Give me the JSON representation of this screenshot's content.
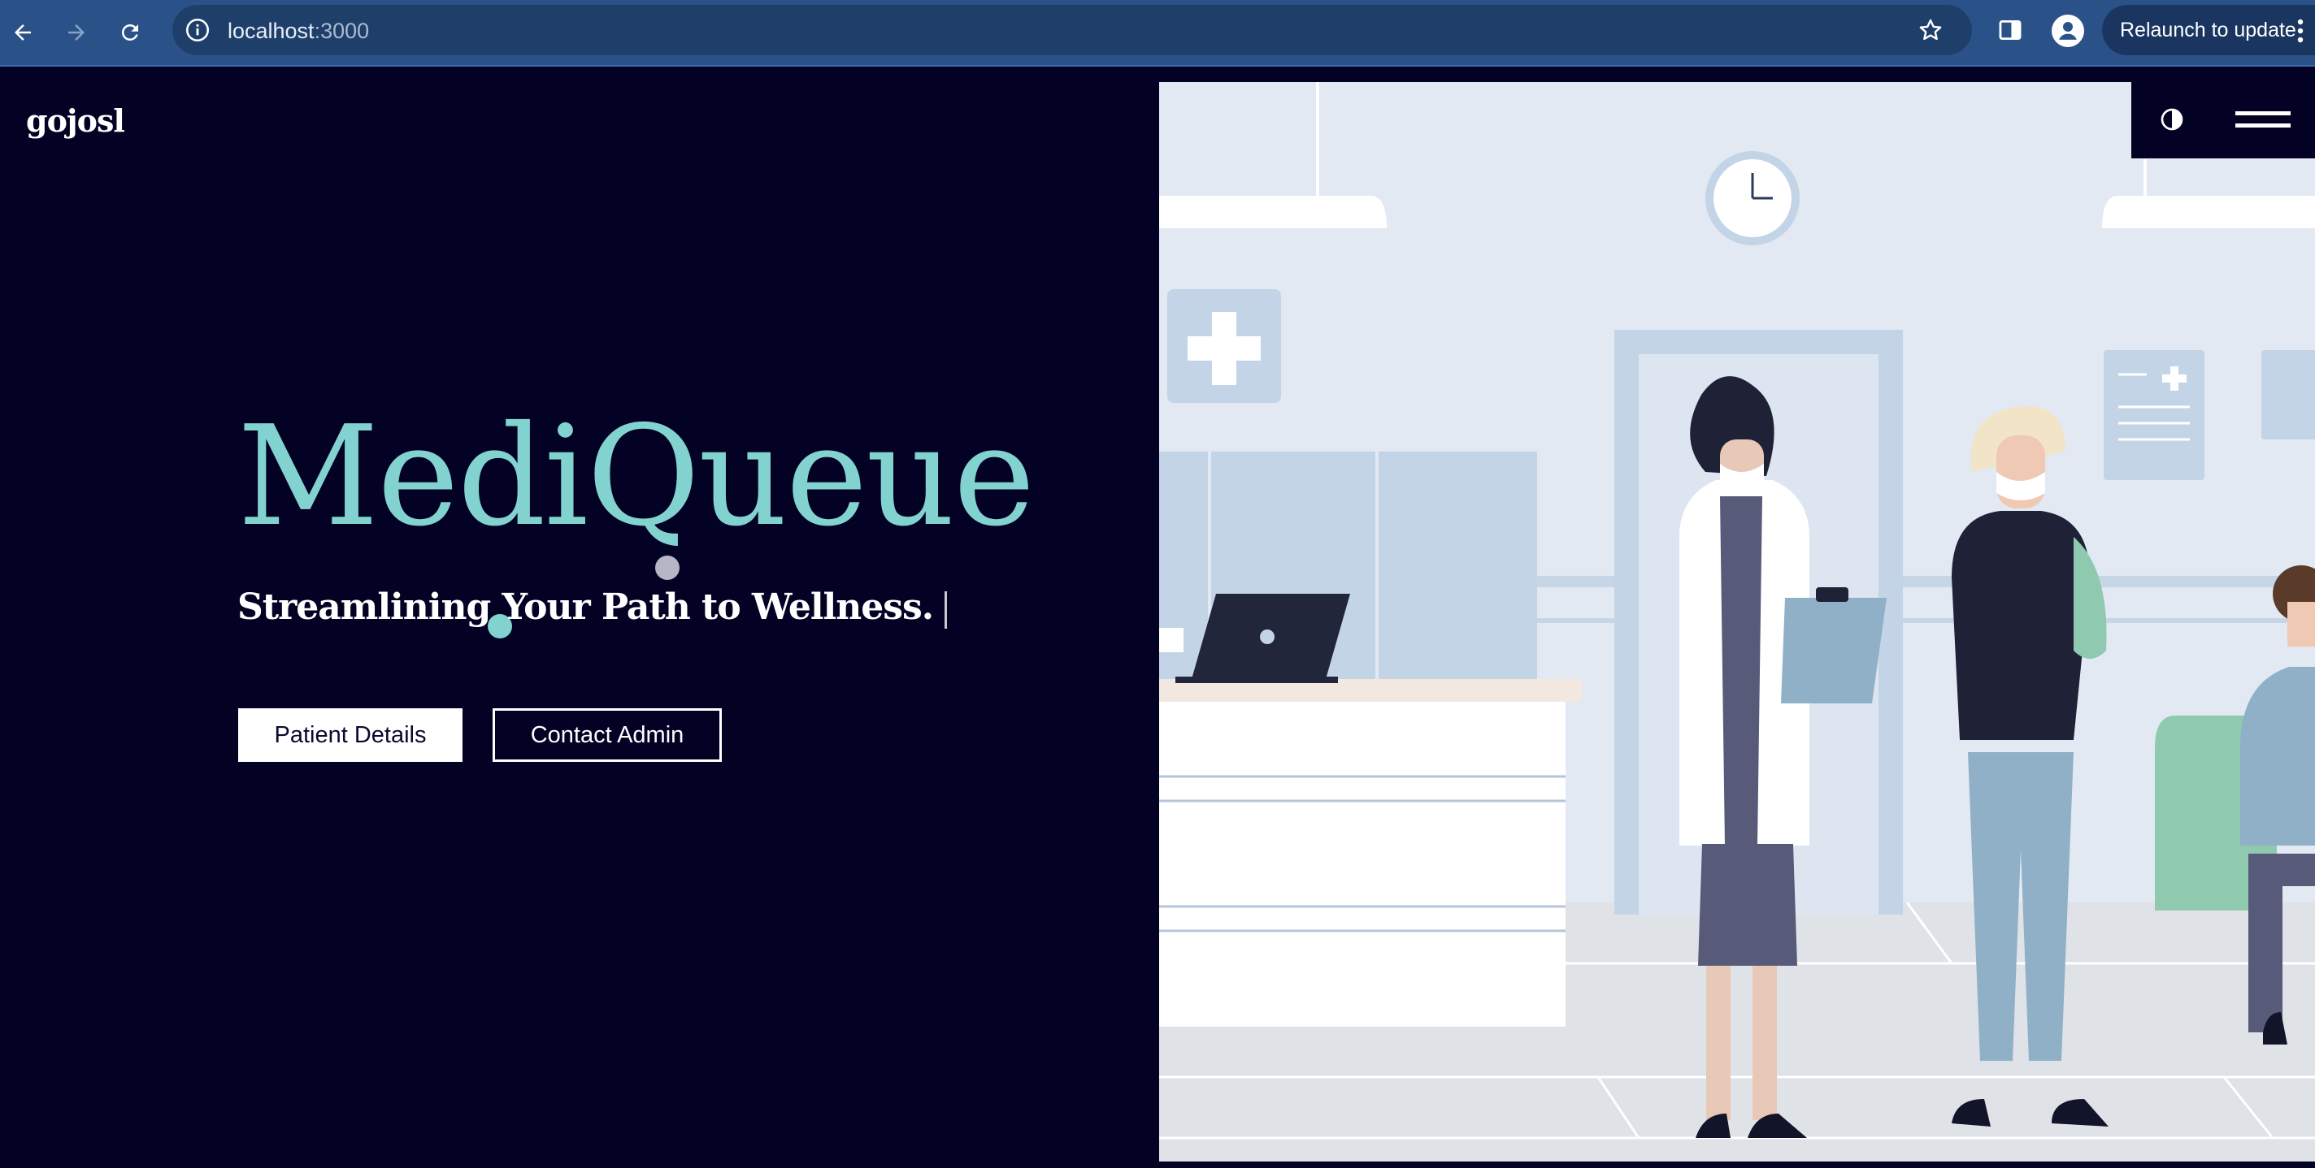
{
  "browser": {
    "url_host": "localhost",
    "url_port": ":3000",
    "relaunch_label": "Relaunch to update",
    "icons": [
      "back-arrow-icon",
      "forward-arrow-icon",
      "reload-icon",
      "site-info-icon",
      "star-icon",
      "side-panel-icon",
      "profile-icon",
      "more-vert-icon"
    ]
  },
  "header": {
    "logo": "gojosl",
    "icons": [
      "theme-toggle-icon",
      "hamburger-menu-icon"
    ]
  },
  "hero": {
    "title": "MediQueue",
    "subtitle": "Streamlining Your Path to Wellness.",
    "buttons": {
      "patient_details": "Patient Details",
      "contact_admin": "Contact Admin"
    }
  },
  "colors": {
    "background": "#040224",
    "accent": "#82d2d0",
    "chrome": "#2b5288"
  }
}
